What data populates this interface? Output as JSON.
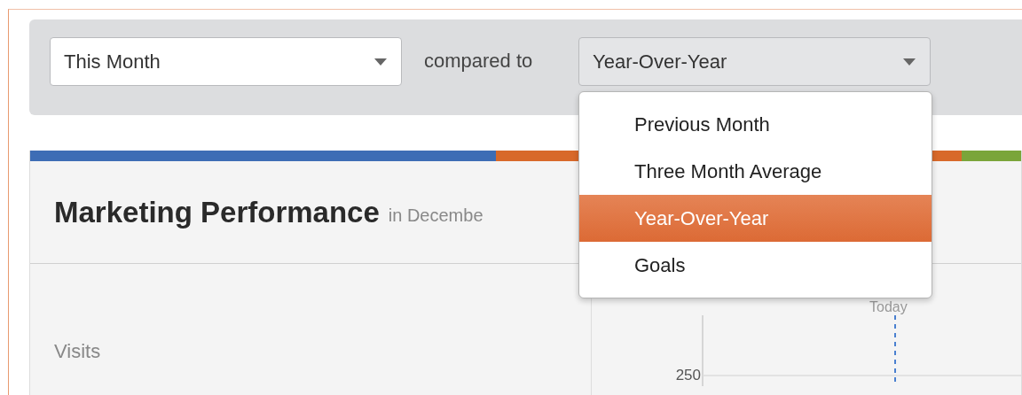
{
  "filters": {
    "period": {
      "value": "This Month"
    },
    "compare_label": "compared to",
    "comparison": {
      "value": "Year-Over-Year",
      "expanded": true,
      "options": [
        {
          "label": "Previous Month",
          "selected": false
        },
        {
          "label": "Three Month Average",
          "selected": false
        },
        {
          "label": "Year-Over-Year",
          "selected": true
        },
        {
          "label": "Goals",
          "selected": false
        }
      ]
    }
  },
  "card": {
    "title": "Marketing Performance",
    "subtitle": "in Decembe",
    "stripe": [
      {
        "color": "#3d6db5"
      },
      {
        "color": "#d8692a"
      },
      {
        "color": "#7aa53a"
      }
    ],
    "metric": {
      "label": "Visits"
    },
    "chart": {
      "marker_label": "Today",
      "tick_label": "250"
    }
  }
}
